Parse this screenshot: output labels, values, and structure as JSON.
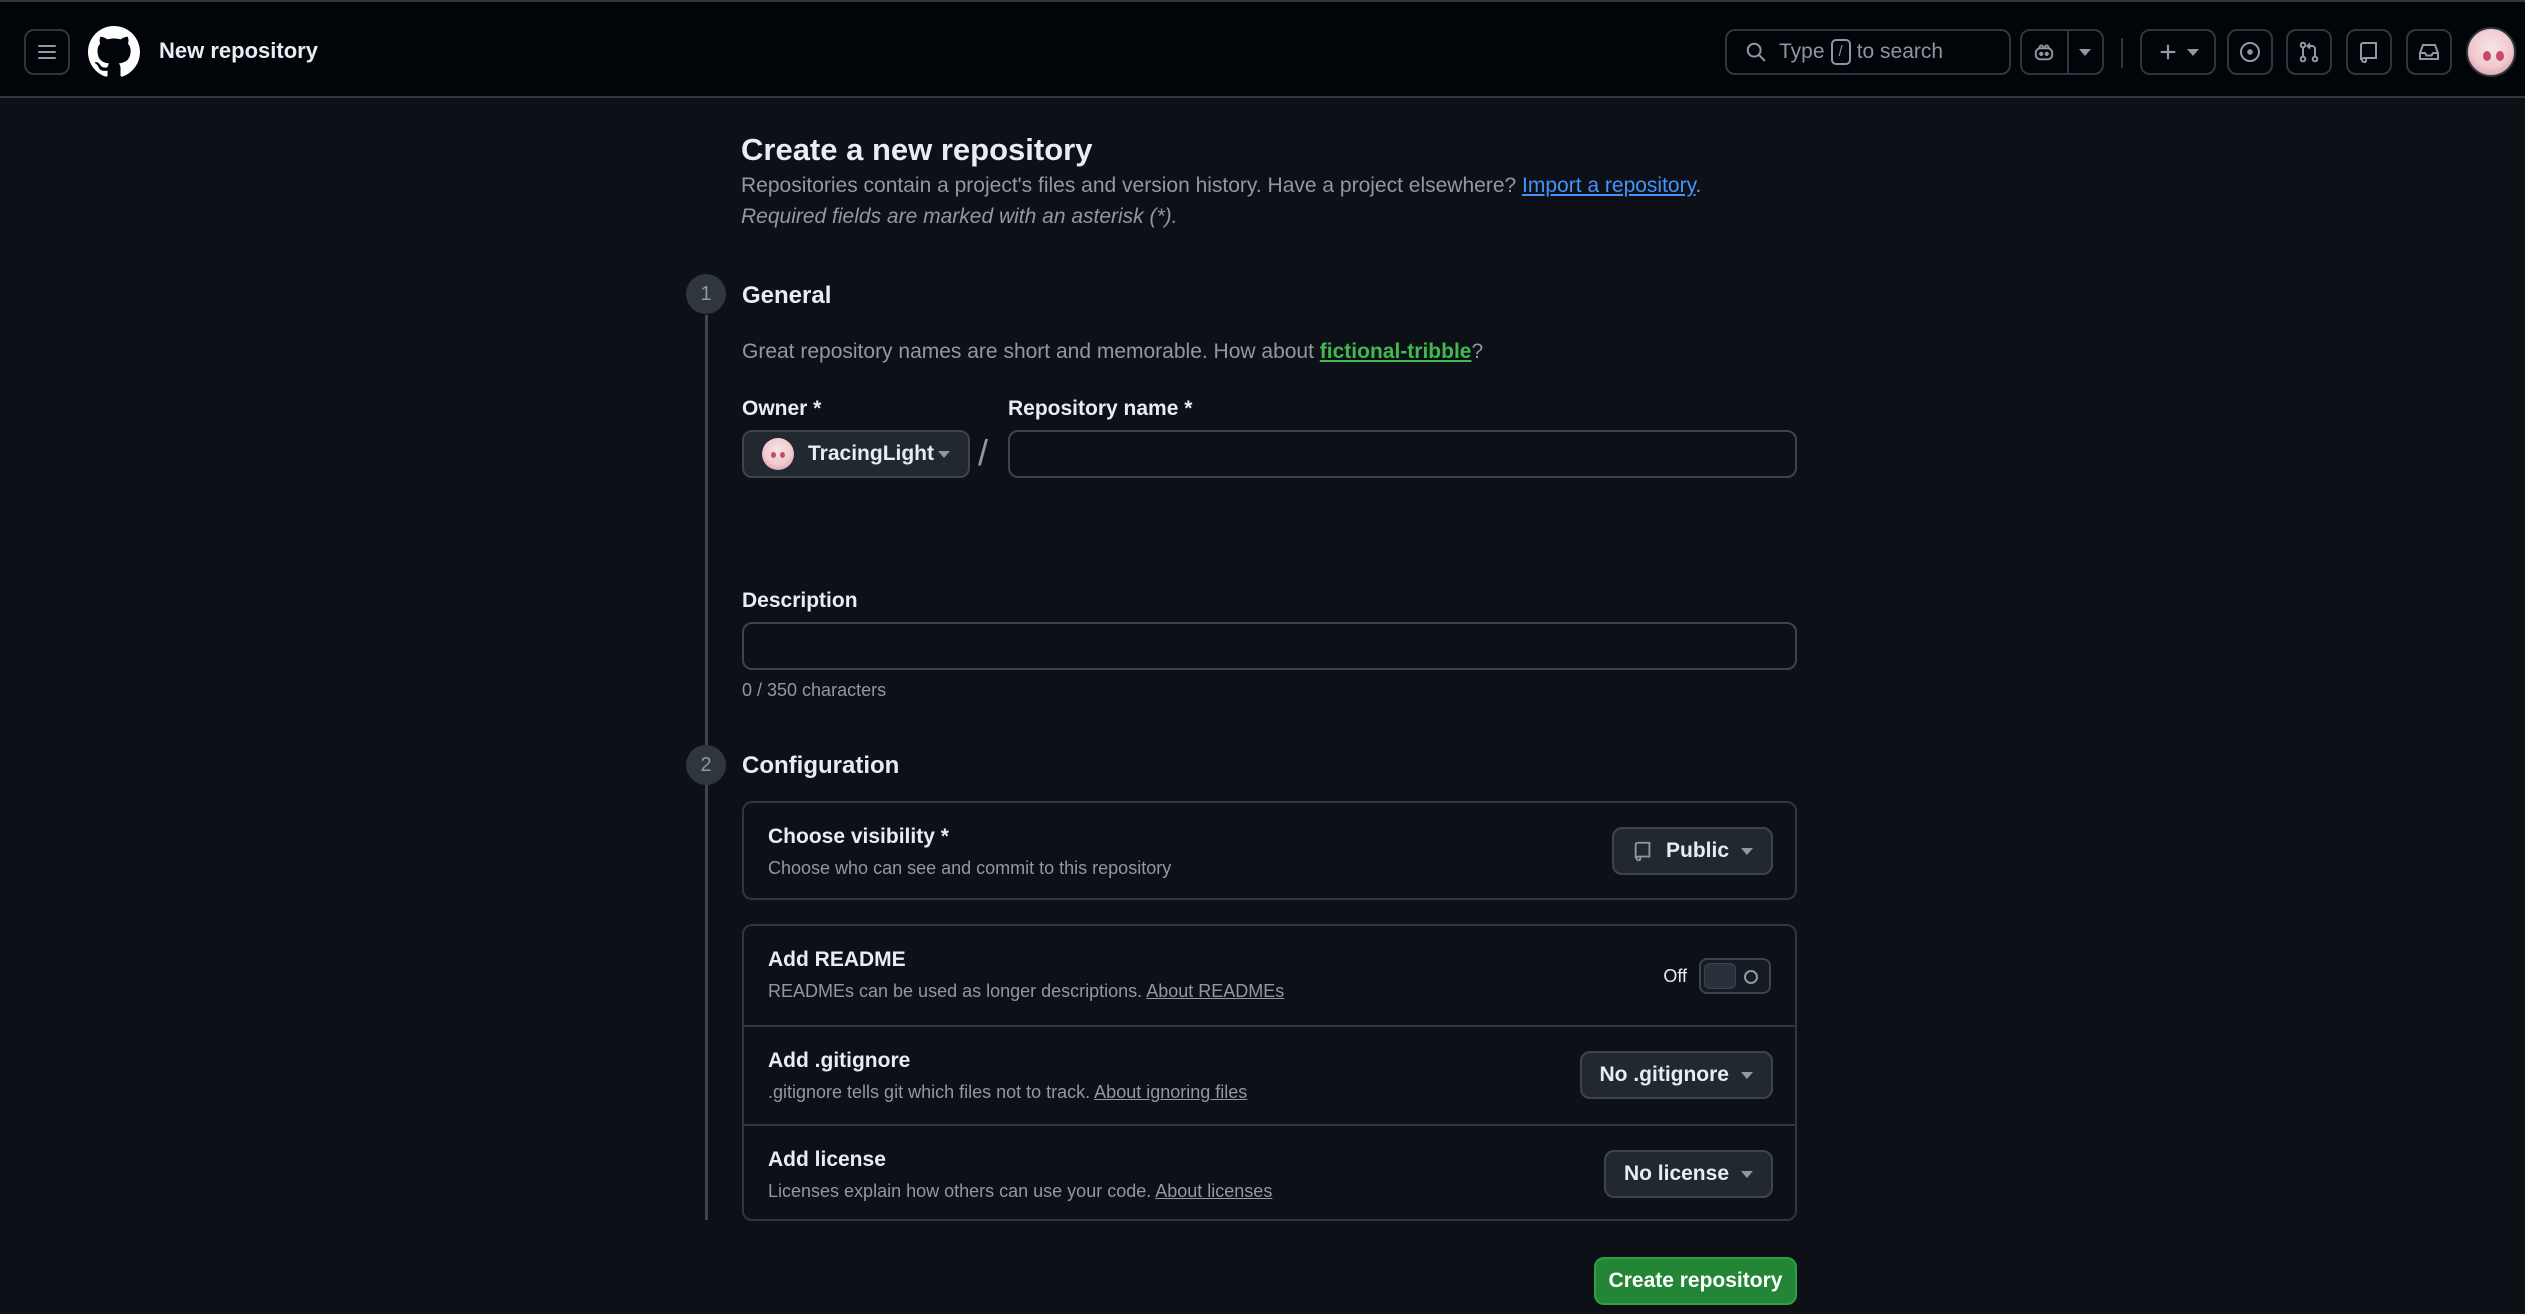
{
  "header": {
    "context_title": "New repository",
    "search": {
      "prefix": "Type",
      "key": "/",
      "suffix": "to search"
    }
  },
  "page": {
    "title": "Create a new repository",
    "subtitle_text": "Repositories contain a project's files and version history. Have a project elsewhere?",
    "import_link": "Import a repository",
    "subtitle_end": ".",
    "required_note": "Required fields are marked with an asterisk (*)."
  },
  "general": {
    "step": "1",
    "heading": "General",
    "suggest_prefix": "Great repository names are short and memorable. How about",
    "suggest_name": "fictional-tribble",
    "suggest_suffix": "?",
    "owner_label": "Owner *",
    "owner_value": "TracingLight",
    "slash": "/",
    "repo_name_label": "Repository name *",
    "repo_name_value": "",
    "description_label": "Description",
    "description_value": "",
    "char_count": "0 / 350 characters"
  },
  "configuration": {
    "step": "2",
    "heading": "Configuration",
    "visibility": {
      "title": "Choose visibility *",
      "desc": "Choose who can see and commit to this repository",
      "value": "Public"
    },
    "readme": {
      "title": "Add README",
      "desc": "READMEs can be used as longer descriptions.",
      "link": "About READMEs",
      "toggle_state": "Off"
    },
    "gitignore": {
      "title": "Add .gitignore",
      "desc": ".gitignore tells git which files not to track.",
      "link": "About ignoring files",
      "value": "No .gitignore"
    },
    "license": {
      "title": "Add license",
      "desc": "Licenses explain how others can use your code.",
      "link": "About licenses",
      "value": "No license"
    }
  },
  "actions": {
    "create_label": "Create repository"
  },
  "colors": {
    "primary": "#238636",
    "link": "#4493f8",
    "suggestion": "#3fb950",
    "bg": "#0d1117"
  }
}
